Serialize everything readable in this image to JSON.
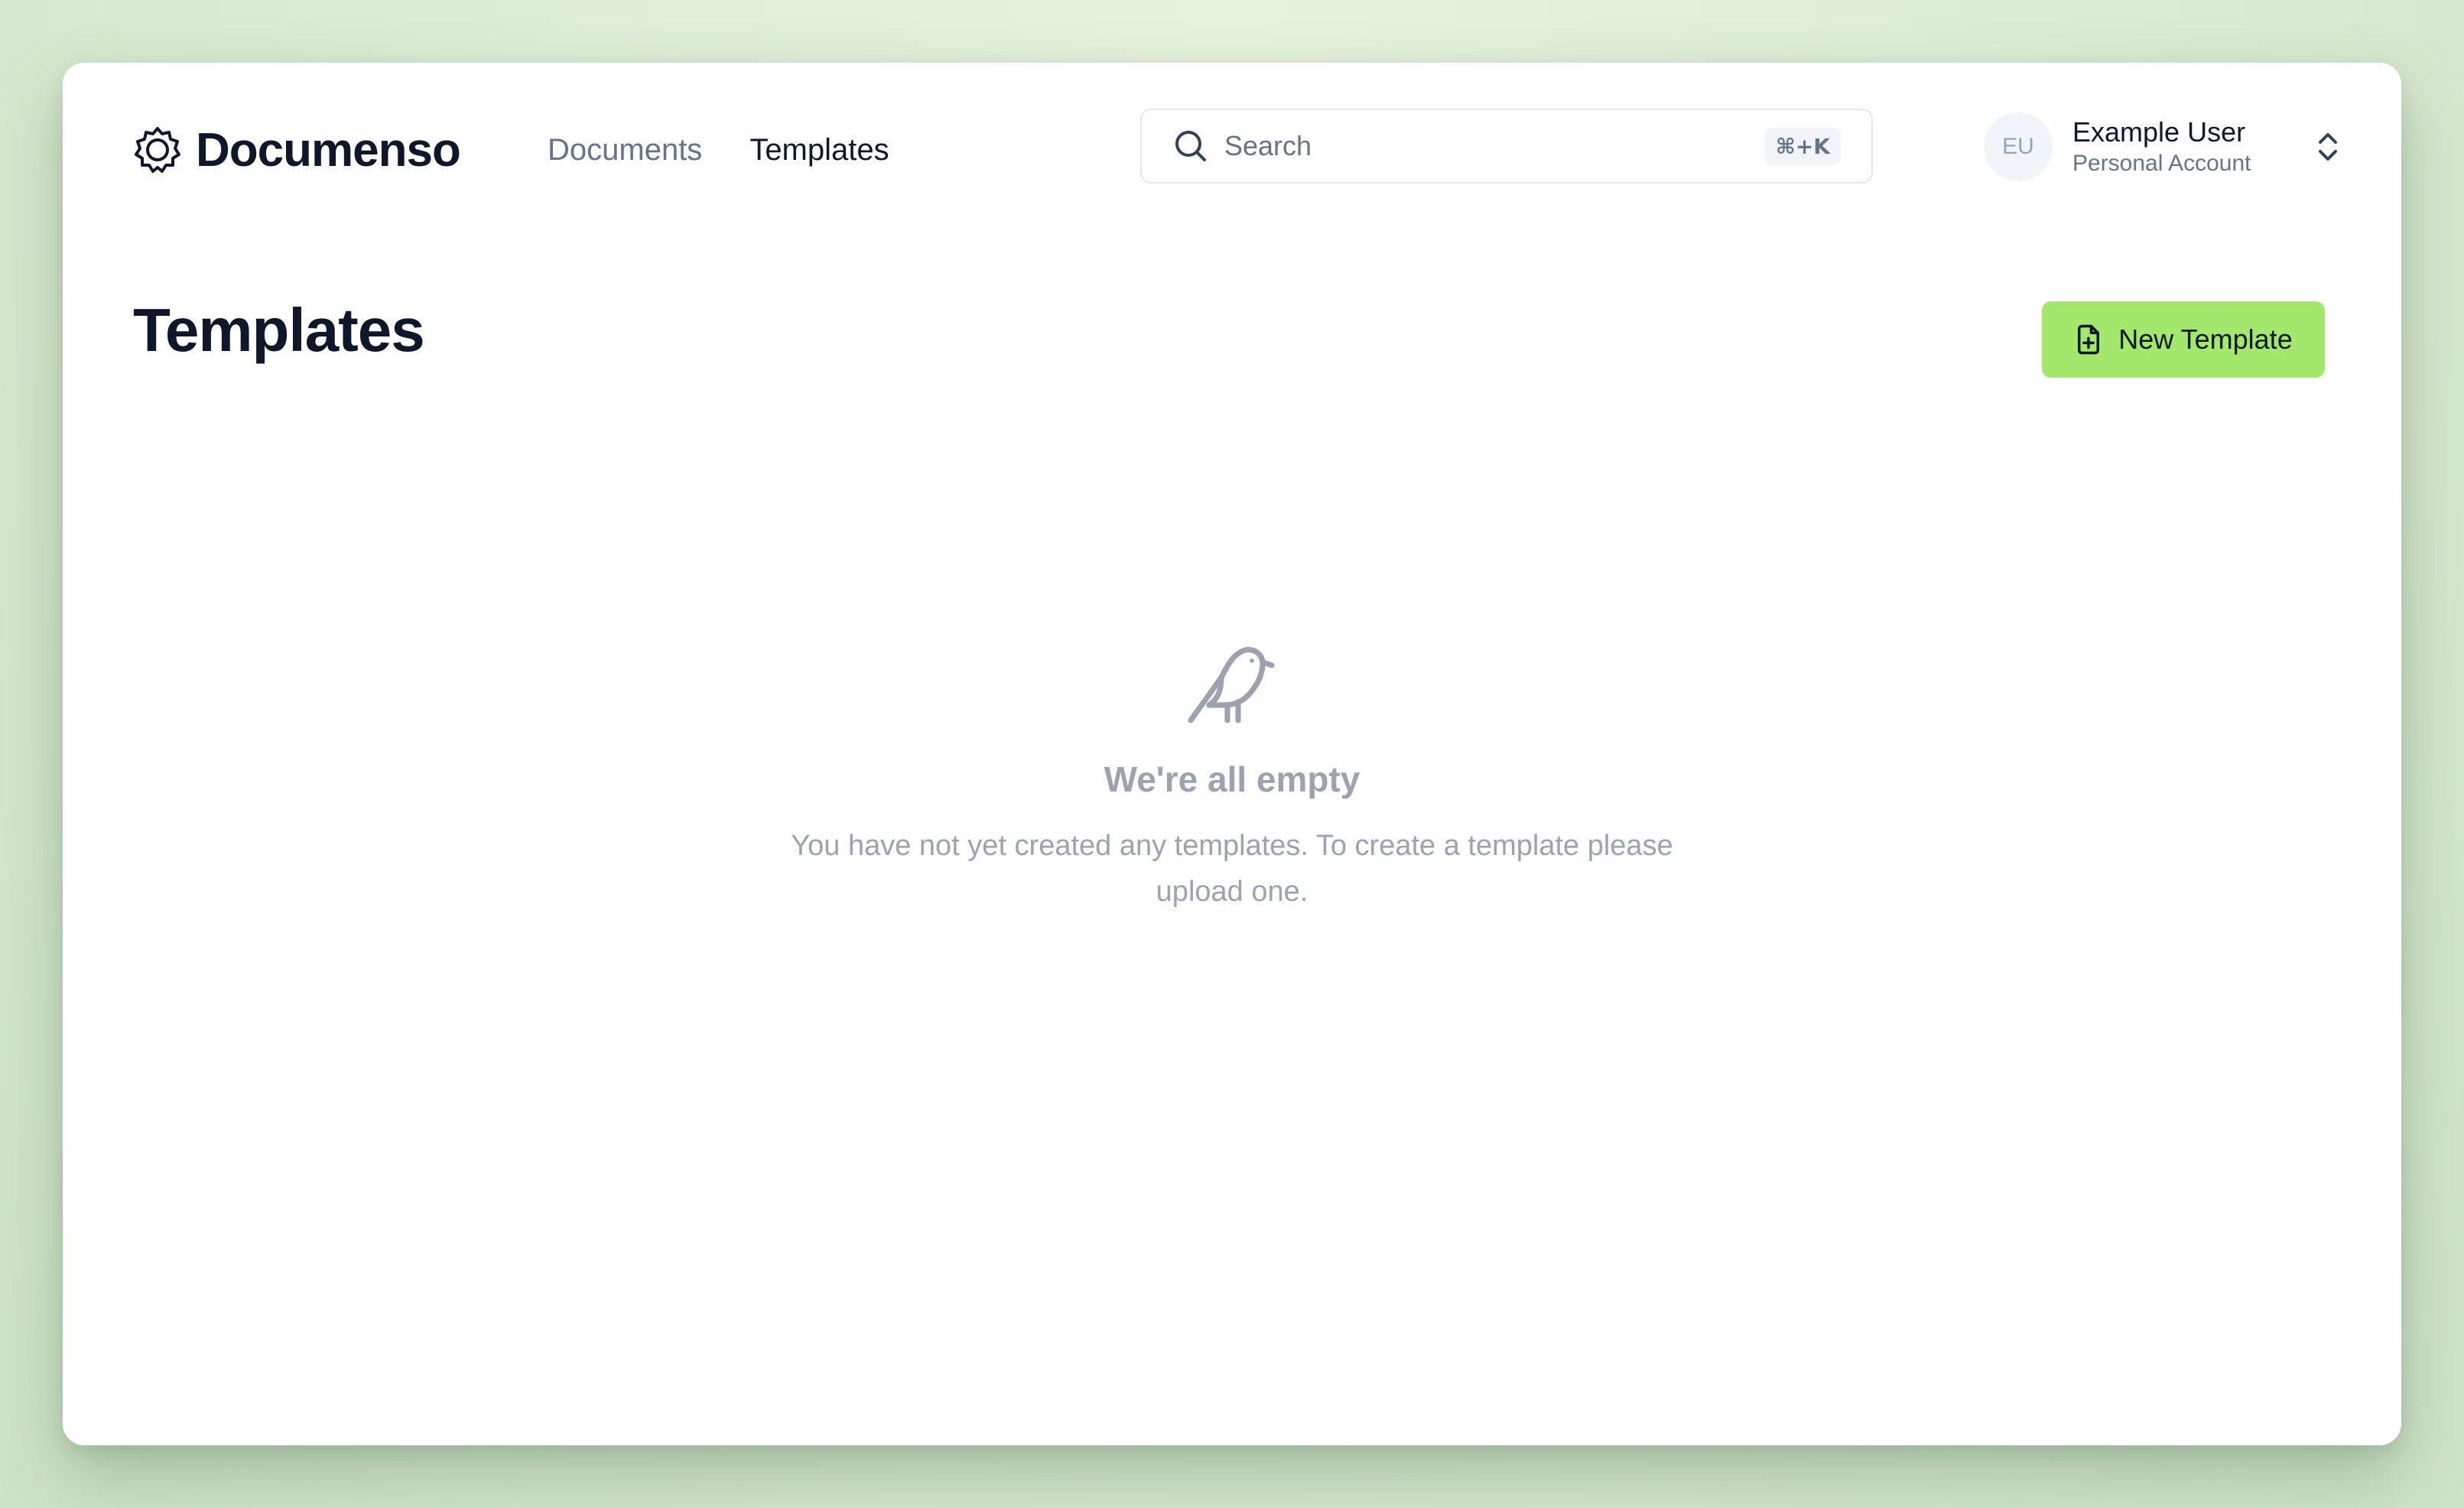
{
  "app": {
    "brand_name": "Documenso"
  },
  "nav": {
    "items": [
      {
        "label": "Documents",
        "active": false
      },
      {
        "label": "Templates",
        "active": true
      }
    ]
  },
  "search": {
    "placeholder": "Search",
    "shortcut": "⌘+K"
  },
  "account": {
    "initials": "EU",
    "name": "Example User",
    "type": "Personal Account"
  },
  "page": {
    "title": "Templates",
    "new_button_label": "New Template"
  },
  "empty_state": {
    "title": "We're all empty",
    "description": "You have not yet created any templates. To create a template please upload one."
  },
  "colors": {
    "accent": "#a3e76d",
    "text_primary": "#0f172a",
    "text_muted": "#9ca3af",
    "background": "#dcedd6"
  },
  "icons": {
    "brand": "documenso-logo-icon",
    "search": "search-icon",
    "account_switch": "chevron-up-down-icon",
    "new_template": "file-plus-icon",
    "empty_state": "bird-icon"
  }
}
